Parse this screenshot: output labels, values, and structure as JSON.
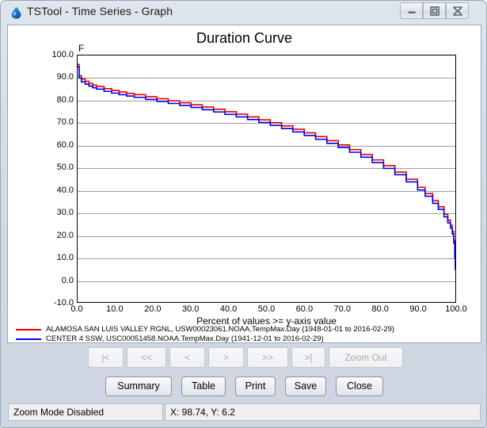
{
  "window": {
    "title": "TSTool - Time Series - Graph",
    "icon": "water-drop-icon",
    "controls": {
      "minimize": "minimize-icon",
      "maximize": "maximize-icon",
      "close": "close-icon"
    }
  },
  "chart_data": {
    "type": "line",
    "title": "Duration Curve",
    "xlabel": "Percent of values >= y-axis value",
    "ylabel": "F",
    "xlim": [
      0.0,
      100.0
    ],
    "ylim": [
      -10.0,
      100.0
    ],
    "grid": true,
    "legend_position": "below",
    "xticks": [
      "0.0",
      "10.0",
      "20.0",
      "30.0",
      "40.0",
      "50.0",
      "60.0",
      "70.0",
      "80.0",
      "90.0",
      "100.0"
    ],
    "yticks": [
      "100.0",
      "90.0",
      "80.0",
      "70.0",
      "60.0",
      "50.0",
      "40.0",
      "30.0",
      "20.0",
      "10.0",
      "0.0",
      "-10.0"
    ],
    "x": [
      0,
      0.4,
      1,
      2,
      3,
      4,
      5,
      7,
      9,
      11,
      13,
      15,
      18,
      21,
      24,
      27,
      30,
      33,
      36,
      39,
      42,
      45,
      48,
      51,
      54,
      57,
      60,
      63,
      66,
      69,
      72,
      75,
      78,
      81,
      84,
      87,
      90,
      92,
      94,
      95.5,
      97,
      98,
      98.7,
      99.2,
      99.6,
      99.85,
      100
    ],
    "series": [
      {
        "name": "ALAMOSA SAN LUIS VALLEY RGNL, USW00023061.NOAA.TempMax.Day (1948-01-01 to 2016-02-29)",
        "color": "#e60000",
        "values": [
          96,
          91,
          89.5,
          88.5,
          87.5,
          86.8,
          86.2,
          85.2,
          84.4,
          83.7,
          83.1,
          82.5,
          81.6,
          80.7,
          79.8,
          78.9,
          78.0,
          77.0,
          76.0,
          74.9,
          73.8,
          72.6,
          71.3,
          70.0,
          68.6,
          67.1,
          65.5,
          63.8,
          62.0,
          60.1,
          58.0,
          55.8,
          53.4,
          50.8,
          48.0,
          44.8,
          41.2,
          38.4,
          35.2,
          32.5,
          29.2,
          26.5,
          24.2,
          21.5,
          17.5,
          11.0,
          5.5
        ]
      },
      {
        "name": "CENTER 4 SSW, USC00051458.NOAA.TempMax.Day (1941-12-01 to 2016-02-29)",
        "color": "#0000e6",
        "values": [
          95,
          90,
          88.2,
          87.2,
          86.3,
          85.6,
          85.0,
          84.0,
          83.2,
          82.5,
          81.9,
          81.3,
          80.4,
          79.5,
          78.6,
          77.7,
          76.8,
          75.8,
          74.8,
          73.7,
          72.6,
          71.4,
          70.1,
          68.8,
          67.4,
          65.9,
          64.3,
          62.6,
          60.8,
          58.9,
          56.8,
          54.6,
          52.2,
          49.6,
          46.8,
          43.6,
          40.0,
          37.2,
          34.0,
          31.3,
          28.0,
          25.3,
          23.0,
          20.3,
          16.3,
          9.8,
          4.2
        ]
      }
    ]
  },
  "legend": [
    {
      "color": "#e60000",
      "label": "ALAMOSA SAN LUIS VALLEY RGNL, USW00023061.NOAA.TempMax.Day (1948-01-01 to 2016-02-29)"
    },
    {
      "color": "#0000e6",
      "label": "CENTER 4 SSW, USC00051458.NOAA.TempMax.Day (1941-12-01 to 2016-02-29)"
    }
  ],
  "nav_buttons": [
    {
      "label": "|<",
      "name": "first"
    },
    {
      "label": "<<",
      "name": "page-back"
    },
    {
      "label": "<",
      "name": "step-back"
    },
    {
      "label": ">",
      "name": "step-forward"
    },
    {
      "label": ">>",
      "name": "page-forward"
    },
    {
      "label": ">|",
      "name": "last"
    },
    {
      "label": "Zoom Out",
      "name": "zoom-out"
    }
  ],
  "action_buttons": [
    {
      "label": "Summary"
    },
    {
      "label": "Table"
    },
    {
      "label": "Print"
    },
    {
      "label": "Save"
    },
    {
      "label": "Close"
    }
  ],
  "statusbar": {
    "mode": "Zoom Mode Disabled",
    "coords": "X:  98.74,  Y:  6.2"
  }
}
